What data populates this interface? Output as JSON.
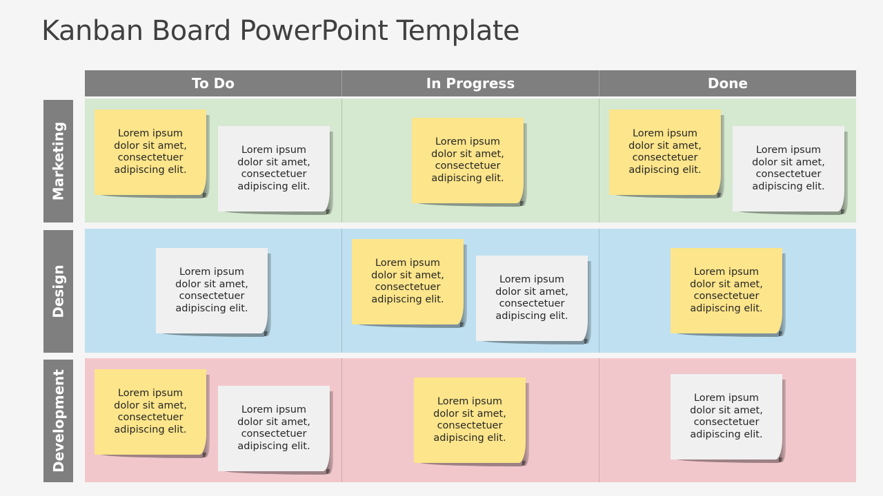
{
  "title": "Kanban Board PowerPoint Template",
  "columns": [
    "To Do",
    "In Progress",
    "Done"
  ],
  "colors": {
    "header": "#7f7f7f",
    "marketing_lane": "#d5e8d0",
    "design_lane": "#bfe0f0",
    "development_lane": "#f2c7cb",
    "note_yellow": "#fce58a",
    "note_white": "#f0f0f0"
  },
  "lanes": [
    {
      "label": "Marketing",
      "cells": [
        {
          "notes": [
            {
              "color": "yellow",
              "text": "Lorem ipsum\ndolor sit amet,\nconsectetuer\nadipiscing elit."
            },
            {
              "color": "white",
              "text": "Lorem ipsum\ndolor sit amet,\nconsectetuer\nadipiscing elit."
            }
          ]
        },
        {
          "notes": [
            {
              "color": "yellow",
              "text": "Lorem ipsum\ndolor sit amet,\nconsectetuer\nadipiscing elit."
            }
          ]
        },
        {
          "notes": [
            {
              "color": "yellow",
              "text": "Lorem ipsum\ndolor sit amet,\nconsectetuer\nadipiscing elit."
            },
            {
              "color": "white",
              "text": "Lorem ipsum\ndolor sit amet,\nconsectetuer\nadipiscing elit."
            }
          ]
        }
      ]
    },
    {
      "label": "Design",
      "cells": [
        {
          "notes": [
            {
              "color": "white",
              "text": "Lorem ipsum\ndolor sit amet,\nconsectetuer\nadipiscing elit."
            }
          ]
        },
        {
          "notes": [
            {
              "color": "yellow",
              "text": "Lorem ipsum\ndolor sit amet,\nconsectetuer\nadipiscing elit."
            },
            {
              "color": "white",
              "text": "Lorem ipsum\ndolor sit amet,\nconsectetuer\nadipiscing elit."
            }
          ]
        },
        {
          "notes": [
            {
              "color": "yellow",
              "text": "Lorem ipsum\ndolor sit amet,\nconsectetuer\nadipiscing elit."
            }
          ]
        }
      ]
    },
    {
      "label": "Development",
      "cells": [
        {
          "notes": [
            {
              "color": "yellow",
              "text": "Lorem ipsum\ndolor sit amet,\nconsectetuer\nadipiscing elit."
            },
            {
              "color": "white",
              "text": "Lorem ipsum\ndolor sit amet,\nconsectetuer\nadipiscing elit."
            }
          ]
        },
        {
          "notes": [
            {
              "color": "yellow",
              "text": "Lorem ipsum\ndolor sit amet,\nconsectetuer\nadipiscing elit."
            }
          ]
        },
        {
          "notes": [
            {
              "color": "white",
              "text": "Lorem ipsum\ndolor sit amet,\nconsectetuer\nadipiscing elit."
            }
          ]
        }
      ]
    }
  ]
}
